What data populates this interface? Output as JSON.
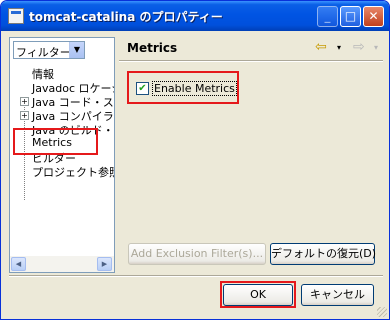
{
  "window": {
    "title": "tomcat-catalina のプロパティー"
  },
  "titlebar_buttons": {
    "minimize": "_",
    "maximize": "□",
    "close": "✕"
  },
  "left": {
    "filter_text": "フィルター入力",
    "combo_arrow": "▼",
    "tree": [
      {
        "label": "情報",
        "expandable": false
      },
      {
        "label": "Javadoc ロケーション",
        "expandable": false
      },
      {
        "label": "Java コード・スタイル",
        "expandable": true
      },
      {
        "label": "Java コンパイラー",
        "expandable": true
      },
      {
        "label": "Java のビルド・パス",
        "expandable": false
      },
      {
        "label": "Metrics",
        "expandable": false
      },
      {
        "label": "ビルダー",
        "expandable": false
      },
      {
        "label": "プロジェクト参照",
        "expandable": false
      }
    ],
    "expander_glyph": "+",
    "scroll_left": "◀",
    "scroll_right": "▶"
  },
  "right": {
    "title": "Metrics",
    "nav_back": "⇦",
    "nav_forward": "⇨",
    "nav_dropdown": "▾",
    "checkbox": {
      "label": "Enable Metrics",
      "checked": true,
      "mark": "✔"
    },
    "add_exclusion_label": "Add Exclusion Filter(s)...",
    "restore_defaults_label": "デフォルトの復元(D)"
  },
  "footer": {
    "ok_label": "OK",
    "cancel_label": "キャンセル"
  },
  "colors": {
    "title_bar": "#0054e3",
    "highlight": "#e5191b",
    "dialog_bg": "#ece9d8"
  }
}
